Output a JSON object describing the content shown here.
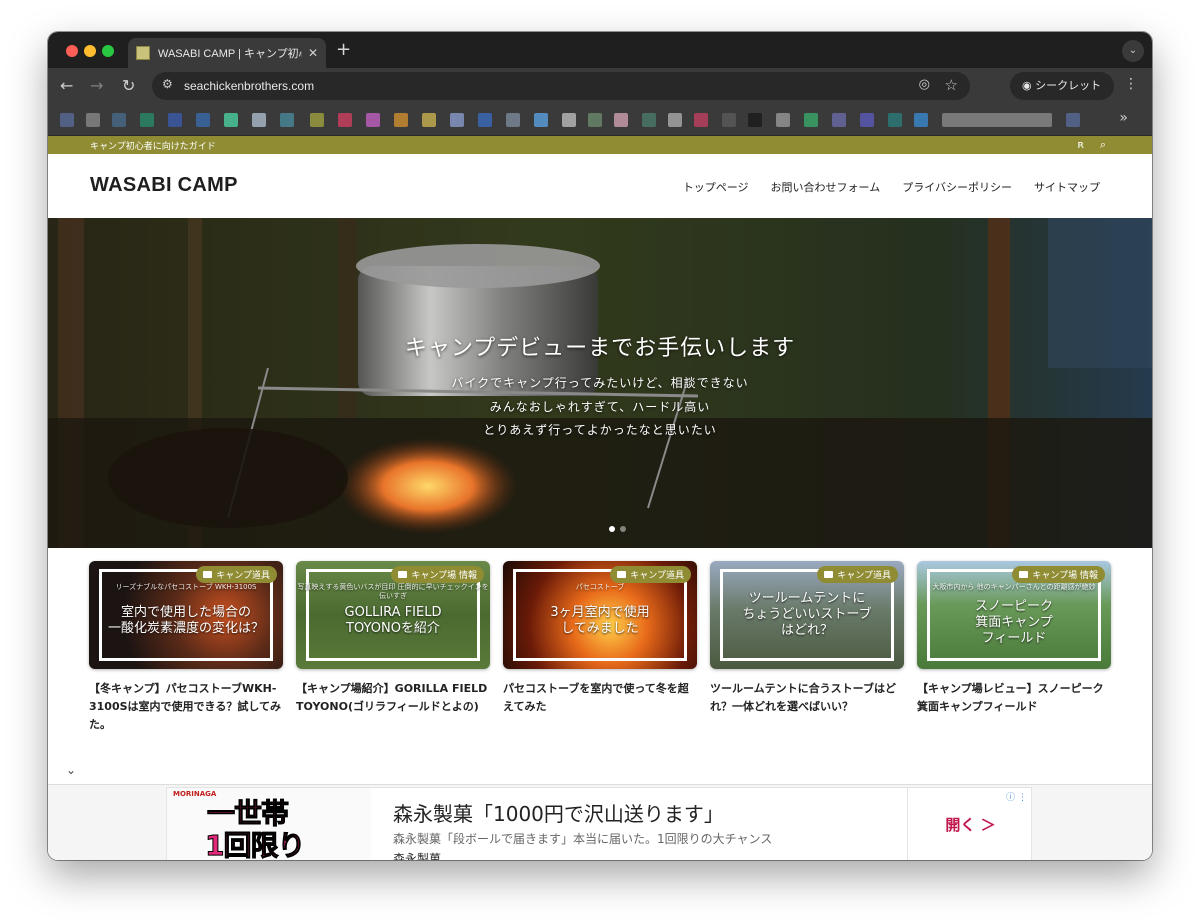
{
  "browser": {
    "tab_title": "WASABI CAMP | キャンプ初心者",
    "tab_close": "✕",
    "new_tab": "+",
    "url": "seachickenbrothers.com",
    "incognito_label": "シークレット",
    "bookmarks_more": "»"
  },
  "site": {
    "tagline": "キャンプ初心者に向けたガイド",
    "logo": "WASABI CAMP",
    "nav": [
      "トップページ",
      "お問い合わせフォーム",
      "プライバシーポリシー",
      "サイトマップ"
    ]
  },
  "hero": {
    "title": "キャンプデビューまでお手伝いします",
    "lines": [
      "バイクでキャンプ行ってみたいけど、相談できない",
      "みんなおしゃれすぎて、ハードル高い",
      "とりあえず行ってよかったなと思いたい"
    ]
  },
  "cards": [
    {
      "category": "キャンプ道具",
      "thumb_small": "リーズナブルなパセコストーブ WKH-3100S",
      "thumb_text": "室内で使用した場合の\n一酸化炭素濃度の変化は？",
      "title": "【冬キャンプ】パセコストーブWKH-3100Sは室内で使用できる？試してみた。"
    },
    {
      "category": "キャンプ場 情報",
      "thumb_small": "写真映えする黄色いバスが目印 圧倒的に早いチェックインを伝いすぎ",
      "thumb_text": "GOLLIRA FIELD\nTOYONOを紹介",
      "title": "【キャンプ場紹介】GORILLA FIELD TOYONO(ゴリラフィールドとよの)"
    },
    {
      "category": "キャンプ道具",
      "thumb_small": "パセコストーブ",
      "thumb_text": "3ヶ月室内で使用\nしてみました",
      "title": "パセコストーブを室内で使って冬を超えてみた"
    },
    {
      "category": "キャンプ道具",
      "thumb_small": "",
      "thumb_text": "ツールームテントに\nちょうどいいストーブ\nはどれ？",
      "title": "ツールームテントに合うストーブはどれ？一体どれを選べばいい？"
    },
    {
      "category": "キャンプ場 情報",
      "thumb_small": "大阪市内から 他のキャンパーさんとの距離感が絶妙",
      "thumb_text": "スノーピーク\n箕面キャンプ\nフィールド",
      "title": "【キャンプ場レビュー】スノーピーク箕面キャンプフィールド"
    }
  ],
  "ad": {
    "brand": "MORINAGA",
    "banner_line1": "一世帯",
    "banner_line2": "1回限り",
    "headline": "森永製菓「1000円で沢山送ります」",
    "description": "森永製菓「段ボールで届きます」本当に届いた。1回限りの大チャンス",
    "advertiser": "森永製菓",
    "cta": "開く ＞",
    "info": "ⓘ ⋮"
  },
  "colors": {
    "accent": "#8f8c34",
    "browser_dark": "#1f1f1f",
    "ad_pink": "#e2287a"
  }
}
